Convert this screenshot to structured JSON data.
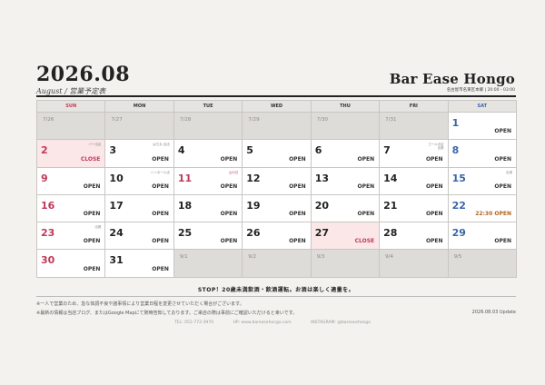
{
  "header": {
    "title": "2026.08",
    "subtitle": "August / 営業予定表",
    "bar_name": "Bar Ease Hongo",
    "address": "名古屋市名東区本郷 | 20:00 - 03:00"
  },
  "weekdays": [
    "SUN",
    "MON",
    "TUE",
    "WED",
    "THU",
    "FRI",
    "SAT"
  ],
  "cells": [
    {
      "day": "7/26",
      "out": true,
      "status": "",
      "note": "",
      "kind": ""
    },
    {
      "day": "7/27",
      "out": true,
      "status": "",
      "note": "",
      "kind": ""
    },
    {
      "day": "7/28",
      "out": true,
      "status": "",
      "note": "",
      "kind": ""
    },
    {
      "day": "7/29",
      "out": true,
      "status": "",
      "note": "",
      "kind": ""
    },
    {
      "day": "7/30",
      "out": true,
      "status": "",
      "note": "",
      "kind": ""
    },
    {
      "day": "7/31",
      "out": true,
      "status": "",
      "note": "",
      "kind": ""
    },
    {
      "day": "1",
      "out": false,
      "status": "OPEN",
      "note": "",
      "kind": "sat"
    },
    {
      "day": "2",
      "out": false,
      "status": "CLOSE",
      "note": "バー出店",
      "kind": "sun",
      "pink": true
    },
    {
      "day": "3",
      "out": false,
      "status": "OPEN",
      "note": "はち丸 出店",
      "kind": ""
    },
    {
      "day": "4",
      "out": false,
      "status": "OPEN",
      "note": "",
      "kind": ""
    },
    {
      "day": "5",
      "out": false,
      "status": "OPEN",
      "note": "",
      "kind": ""
    },
    {
      "day": "6",
      "out": false,
      "status": "OPEN",
      "note": "",
      "kind": ""
    },
    {
      "day": "7",
      "out": false,
      "status": "OPEN",
      "note": "ゴール出店\n出張",
      "kind": ""
    },
    {
      "day": "8",
      "out": false,
      "status": "OPEN",
      "note": "",
      "kind": "sat"
    },
    {
      "day": "9",
      "out": false,
      "status": "OPEN",
      "note": "",
      "kind": "sun"
    },
    {
      "day": "10",
      "out": false,
      "status": "OPEN",
      "note": "ハイボール店",
      "kind": ""
    },
    {
      "day": "11",
      "out": false,
      "status": "OPEN",
      "note": "山の日",
      "kind": "hol",
      "noteRed": true
    },
    {
      "day": "12",
      "out": false,
      "status": "OPEN",
      "note": "",
      "kind": ""
    },
    {
      "day": "13",
      "out": false,
      "status": "OPEN",
      "note": "",
      "kind": ""
    },
    {
      "day": "14",
      "out": false,
      "status": "OPEN",
      "note": "",
      "kind": ""
    },
    {
      "day": "15",
      "out": false,
      "status": "OPEN",
      "note": "出張",
      "kind": "sat"
    },
    {
      "day": "16",
      "out": false,
      "status": "OPEN",
      "note": "",
      "kind": "sun"
    },
    {
      "day": "17",
      "out": false,
      "status": "OPEN",
      "note": "",
      "kind": ""
    },
    {
      "day": "18",
      "out": false,
      "status": "OPEN",
      "note": "",
      "kind": ""
    },
    {
      "day": "19",
      "out": false,
      "status": "OPEN",
      "note": "",
      "kind": ""
    },
    {
      "day": "20",
      "out": false,
      "status": "OPEN",
      "note": "",
      "kind": ""
    },
    {
      "day": "21",
      "out": false,
      "status": "OPEN",
      "note": "",
      "kind": ""
    },
    {
      "day": "22",
      "out": false,
      "status": "22:30 OPEN",
      "note": "",
      "kind": "sat",
      "special": true
    },
    {
      "day": "23",
      "out": false,
      "status": "OPEN",
      "note": "出張",
      "kind": "sun"
    },
    {
      "day": "24",
      "out": false,
      "status": "OPEN",
      "note": "",
      "kind": ""
    },
    {
      "day": "25",
      "out": false,
      "status": "OPEN",
      "note": "",
      "kind": ""
    },
    {
      "day": "26",
      "out": false,
      "status": "OPEN",
      "note": "",
      "kind": ""
    },
    {
      "day": "27",
      "out": false,
      "status": "CLOSE",
      "note": "",
      "kind": "",
      "pink": true
    },
    {
      "day": "28",
      "out": false,
      "status": "OPEN",
      "note": "",
      "kind": ""
    },
    {
      "day": "29",
      "out": false,
      "status": "OPEN",
      "note": "",
      "kind": "sat"
    },
    {
      "day": "30",
      "out": false,
      "status": "OPEN",
      "note": "",
      "kind": "sun"
    },
    {
      "day": "31",
      "out": false,
      "status": "OPEN",
      "note": "",
      "kind": ""
    },
    {
      "day": "9/1",
      "out": true,
      "status": "",
      "note": "",
      "kind": ""
    },
    {
      "day": "9/2",
      "out": true,
      "status": "",
      "note": "",
      "kind": ""
    },
    {
      "day": "9/3",
      "out": true,
      "status": "",
      "note": "",
      "kind": ""
    },
    {
      "day": "9/4",
      "out": true,
      "status": "",
      "note": "",
      "kind": ""
    },
    {
      "day": "9/5",
      "out": true,
      "status": "",
      "note": "",
      "kind": ""
    }
  ],
  "footer": {
    "warning": "STOP！20歳未満飲酒・飲酒運転。お酒は楽しく適量を。",
    "note1": "※一人で営業のため、急な体調不良や諸事情により営業日程を変更させていただく場合がございます。",
    "note2": "※最新の情報は当店ブログ、またはGoogle Mapにて随時告知しております。ご来店の際は事前にご確認いただけると幸いです。",
    "update": "2026.08.03 Update",
    "tel": "TEL: 052-772-3970",
    "hp": "HP: www.bareasehongo.com",
    "instagram": "INSTAGRAM: @bareasehongo"
  },
  "colors": {
    "sunday": "#c0395a",
    "saturday": "#3a66a8",
    "close": "#c0395a",
    "special": "#b5651d",
    "pink_bg": "#fbe7e8",
    "out_bg": "#dedcd9"
  }
}
